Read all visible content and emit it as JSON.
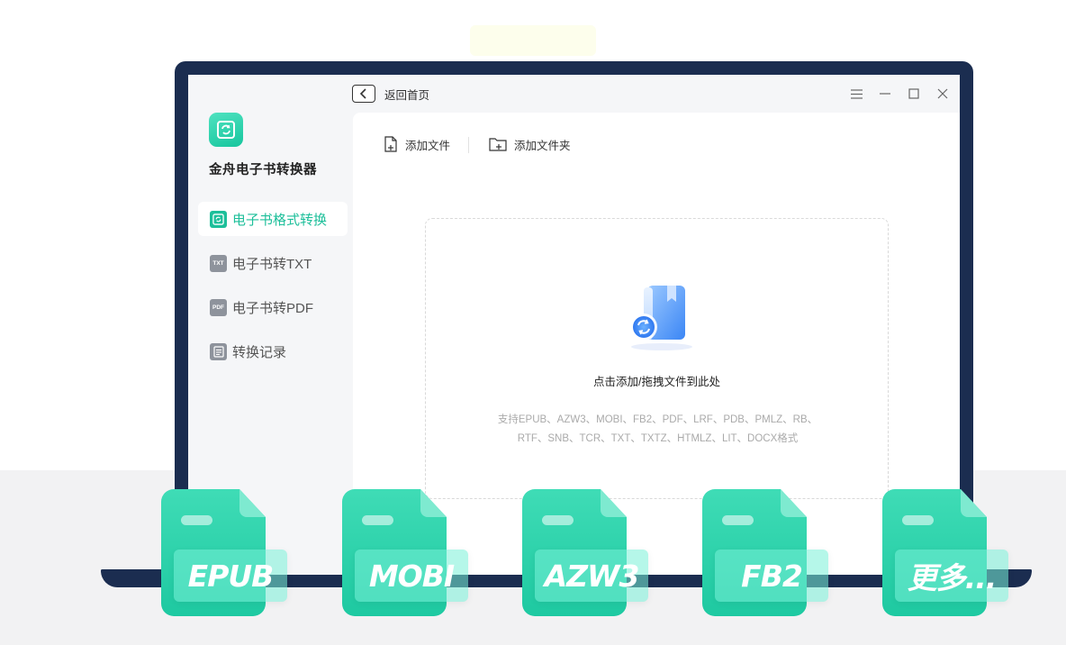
{
  "app": {
    "name": "金舟电子书转换器",
    "logo_icon": "sync-book-icon",
    "accent_color": "#1dbf9a"
  },
  "titlebar": {
    "back_label": "返回首页",
    "controls": [
      "menu-icon",
      "minimize-icon",
      "maximize-icon",
      "close-icon"
    ]
  },
  "sidebar": {
    "items": [
      {
        "label": "电子书格式转换",
        "icon": "convert-icon",
        "active": true
      },
      {
        "label": "电子书转TXT",
        "icon": "txt-icon",
        "icon_text": "TXT",
        "active": false
      },
      {
        "label": "电子书转PDF",
        "icon": "pdf-icon",
        "icon_text": "PDF",
        "active": false
      },
      {
        "label": "转换记录",
        "icon": "history-icon",
        "active": false
      }
    ]
  },
  "toolbar": {
    "add_file": "添加文件",
    "add_folder": "添加文件夹"
  },
  "dropzone": {
    "prompt": "点击添加/拖拽文件到此处",
    "formats_line1": "支持EPUB、AZW3、MOBI、FB2、PDF、LRF、PDB、PMLZ、RB、",
    "formats_line2": "RTF、SNB、TCR、TXT、TXTZ、HTMLZ、LIT、DOCX格式"
  },
  "tiles": [
    "EPUB",
    "MOBI",
    "AZW3",
    "FB2",
    "更多..."
  ]
}
